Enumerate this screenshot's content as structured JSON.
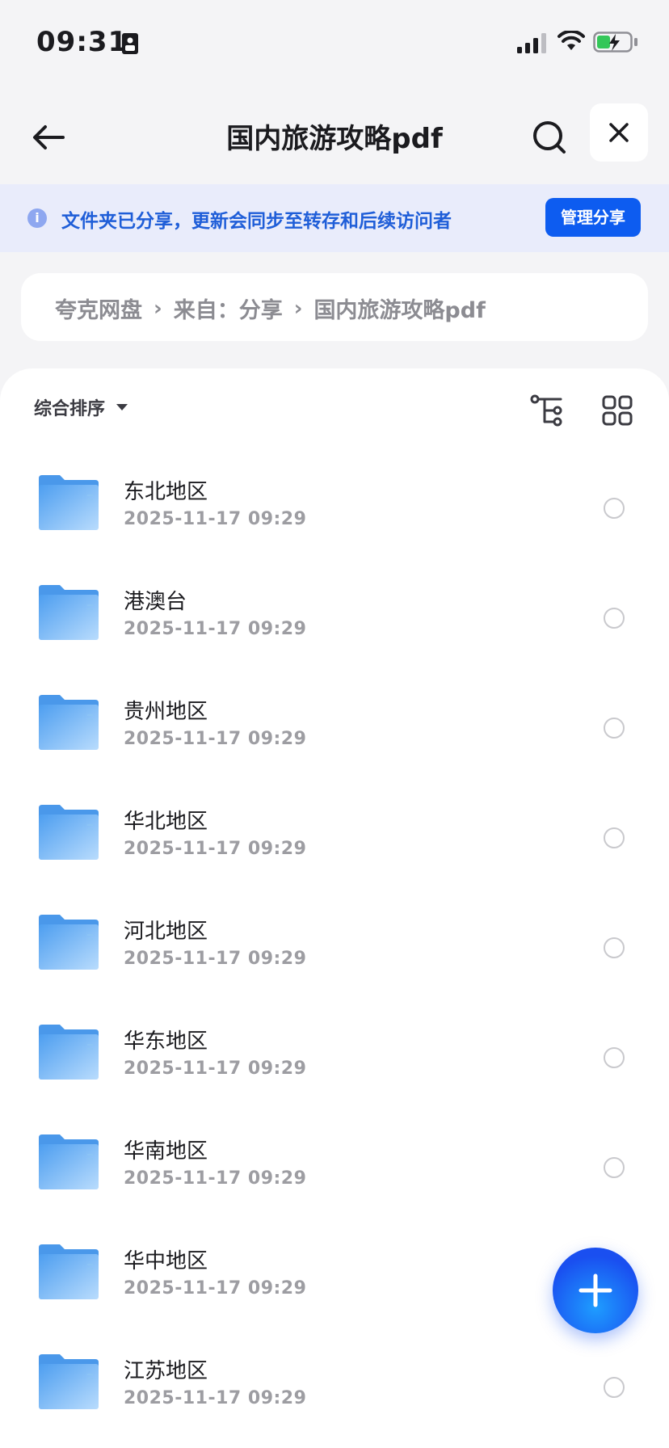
{
  "status_bar": {
    "time": "09:31"
  },
  "nav": {
    "title": "国内旅游攻略pdf"
  },
  "banner": {
    "text": "文件夹已分享，更新会同步至转存和后续访问者",
    "manage_label": "管理分享"
  },
  "breadcrumb": {
    "items": [
      "夸克网盘",
      "来自：分享",
      "国内旅游攻略pdf"
    ]
  },
  "toolbar": {
    "sort_label": "综合排序"
  },
  "files": [
    {
      "name": "东北地区",
      "date": "2025-11-17 09:29"
    },
    {
      "name": "港澳台",
      "date": "2025-11-17 09:29"
    },
    {
      "name": "贵州地区",
      "date": "2025-11-17 09:29"
    },
    {
      "name": "华北地区",
      "date": "2025-11-17 09:29"
    },
    {
      "name": "河北地区",
      "date": "2025-11-17 09:29"
    },
    {
      "name": "华东地区",
      "date": "2025-11-17 09:29"
    },
    {
      "name": "华南地区",
      "date": "2025-11-17 09:29"
    },
    {
      "name": "华中地区",
      "date": "2025-11-17 09:29"
    },
    {
      "name": "江苏地区",
      "date": "2025-11-17 09:29"
    }
  ],
  "colors": {
    "accent": "#0d5cf0",
    "banner_bg": "#e9ecfb",
    "banner_text": "#1f5ed8",
    "folder": "#5aa8f4"
  },
  "icons": [
    "sim-icon",
    "signal-icon",
    "wifi-icon",
    "battery-icon",
    "back-arrow-icon",
    "search-icon",
    "close-icon",
    "info-icon",
    "chevron-right-icon",
    "caret-down-icon",
    "tree-view-icon",
    "grid-view-icon",
    "folder-icon",
    "plus-icon"
  ]
}
